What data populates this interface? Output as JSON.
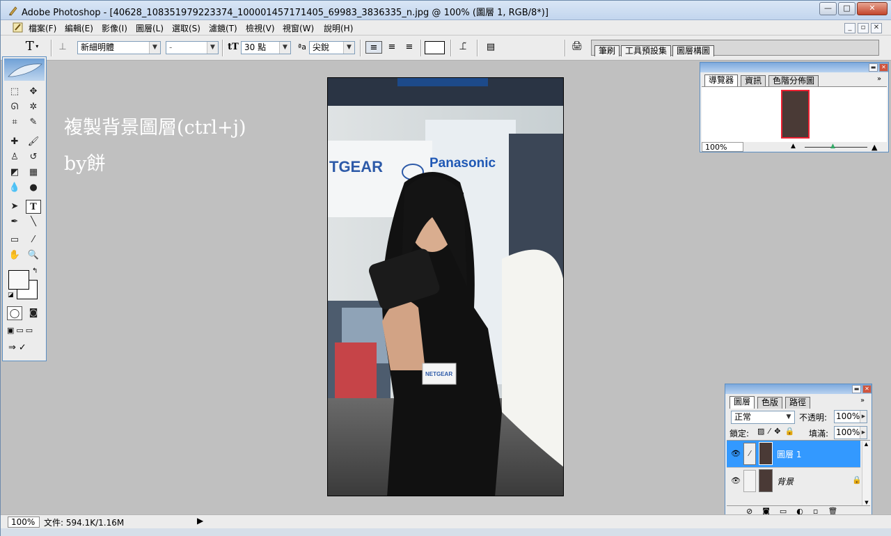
{
  "window": {
    "title": "Adobe Photoshop - [40628_108351979223374_100001457171405_69983_3836335_n.jpg @ 100% (圖層 1, RGB/8*)]",
    "min_label": "—",
    "max_label": "□",
    "close_label": "✕"
  },
  "menu": {
    "items": [
      "檔案(F)",
      "編輯(E)",
      "影像(I)",
      "圖層(L)",
      "選取(S)",
      "濾鏡(T)",
      "檢視(V)",
      "視窗(W)",
      "說明(H)"
    ]
  },
  "options": {
    "tool_glyph": "T",
    "font_family": "新細明體",
    "font_style": "-",
    "font_size": "30 點",
    "aa_label": "ªa",
    "antialias": "尖銳",
    "well_tabs": [
      "筆刷",
      "工具預設集",
      "圖層構圖"
    ]
  },
  "caption": {
    "line1": "複製背景圖層(ctrl+j)",
    "line2": "by餅"
  },
  "navigator": {
    "tabs": [
      "導覽器",
      "資訊",
      "色階分佈圖"
    ],
    "zoom": "100%"
  },
  "layers": {
    "tabs": [
      "圖層",
      "色版",
      "路徑"
    ],
    "blend_mode": "正常",
    "opacity_label": "不透明:",
    "opacity": "100%",
    "lock_label": "鎖定:",
    "fill_label": "填滿:",
    "fill": "100%",
    "rows": [
      {
        "name": "圖層 1",
        "selected": true
      },
      {
        "name": "背景",
        "selected": false
      }
    ]
  },
  "status": {
    "zoom": "100%",
    "doc_info": "文件: 594.1K/1.16M"
  },
  "colors": {
    "selection": "#3399ff",
    "panel_head": "#7ca9dd",
    "canvas": "#c0c0c0"
  }
}
